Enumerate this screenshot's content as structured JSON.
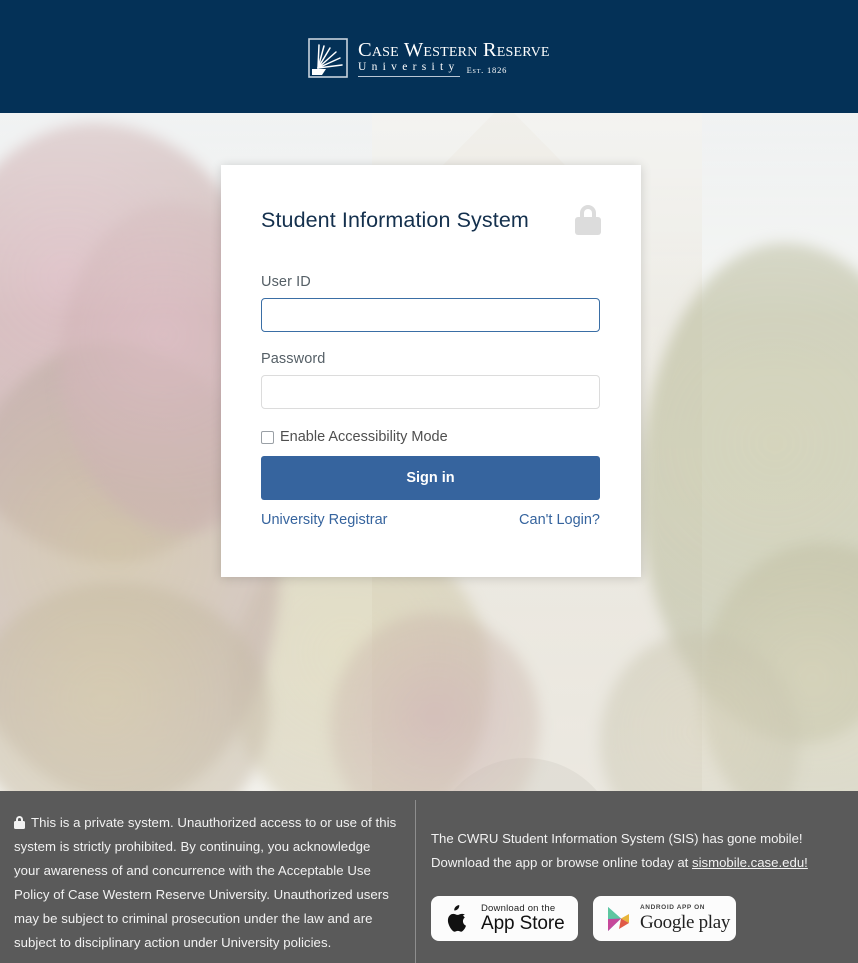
{
  "header": {
    "logo_mark": "cwru-sunburst-book-logo",
    "logo_line1": "Case Western Reserve",
    "logo_line2": "University",
    "logo_est": "Est. 1826",
    "background_color": "#043157"
  },
  "card": {
    "title": "Student Information System",
    "lock_icon": "lock-icon",
    "userid_label": "User ID",
    "userid_value": "",
    "userid_placeholder": "",
    "password_label": "Password",
    "password_value": "",
    "password_placeholder": "",
    "accessibility_label": "Enable Accessibility Mode",
    "accessibility_checked": false,
    "signin_label": "Sign in",
    "registrar_link": "University Registrar",
    "cant_login_link": "Can't Login?",
    "accent_color": "#36649e",
    "title_color": "#14304d"
  },
  "footer": {
    "privacy_icon": "lock-icon",
    "privacy_text": "This is a private system. Unauthorized access to or use of this system is strictly prohibited. By continuing, you acknowledge your awareness of and concurrence with the Acceptable Use Policy of Case Western Reserve University. Unauthorized users may be subject to criminal prosecution under the law and are subject to disciplinary action under University policies.",
    "mobile_line1": "The CWRU Student Information System (SIS) has gone mobile!",
    "mobile_line2_prefix": "Download the app or browse online today at ",
    "mobile_link": "sismobile.case.edu!",
    "apple_badge": {
      "icon": "apple-icon",
      "small_text": "Download on the",
      "large_text": "App Store"
    },
    "google_badge": {
      "icon": "google-play-icon",
      "small_text": "ANDROID APP ON",
      "large_text": "Google play"
    },
    "background_color": "#5a5a5a"
  }
}
